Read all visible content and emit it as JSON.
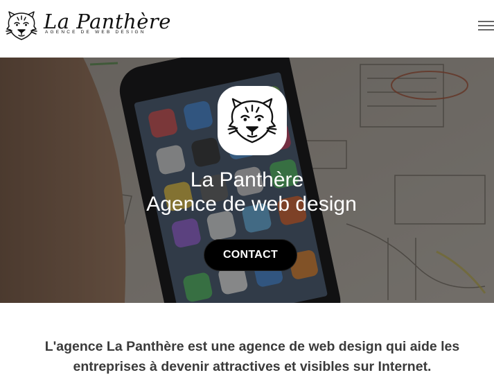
{
  "header": {
    "brand_name": "La Panthère",
    "brand_tagline": "AGENCE DE WEB DESIGN",
    "logo_icon": "panther-head-icon",
    "menu_icon": "hamburger-menu-icon"
  },
  "hero": {
    "logo_icon": "panther-head-icon",
    "title": "La Panthère",
    "subtitle": "Agence de web design",
    "cta_label": "CONTACT"
  },
  "intro": {
    "line1": "L'agence La Panthère est une agence de web design qui aide les",
    "line2": "entreprises à devenir attractives et visibles sur Internet."
  },
  "colors": {
    "cta_background": "#000000",
    "hero_text": "#ffffff",
    "body_text": "#3a3a3a"
  }
}
